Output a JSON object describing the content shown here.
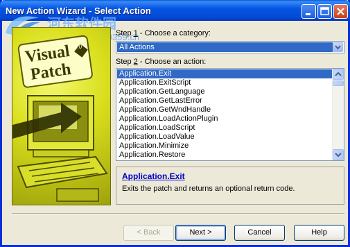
{
  "window": {
    "title": "New Action Wizard - Select Action",
    "controls": {
      "minimize": "minimize",
      "maximize": "maximize",
      "close": "close"
    }
  },
  "watermark": {
    "text": "河东软件园",
    "url": "www.pc0359.cn"
  },
  "side_image": {
    "brand_line1": "Visual",
    "brand_line2": "Patch",
    "version": "2.0"
  },
  "step1": {
    "prefix": "Step ",
    "number": "1",
    "text": " - Choose a category:"
  },
  "category": {
    "selected": "All Actions"
  },
  "step2": {
    "prefix": "Step ",
    "number": "2",
    "text": " - Choose an action:"
  },
  "actions": {
    "items": [
      "Application.Exit",
      "Application.ExitScript",
      "Application.GetLanguage",
      "Application.GetLastError",
      "Application.GetWndHandle",
      "Application.LoadActionPlugin",
      "Application.LoadScript",
      "Application.LoadValue",
      "Application.Minimize",
      "Application.Restore"
    ],
    "selected_index": 0
  },
  "description": {
    "title": "Application.Exit",
    "text": "Exits the patch and returns an optional return code."
  },
  "buttons": {
    "back": "< Back",
    "next": "Next >",
    "cancel": "Cancel",
    "help": "Help"
  },
  "colors": {
    "title_bar": "#0556e4",
    "selection": "#316ac5",
    "dialog_bg": "#ece9d8",
    "link": "#0000c8"
  }
}
